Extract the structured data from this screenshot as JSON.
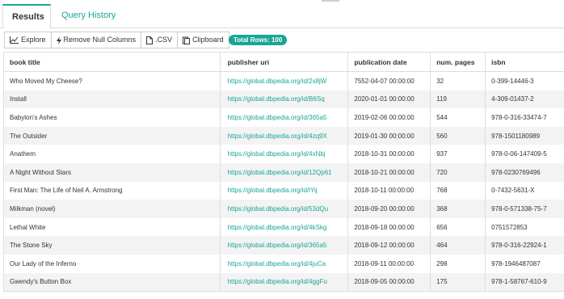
{
  "tabs": {
    "results": "Results",
    "history": "Query History"
  },
  "toolbar": {
    "explore": "Explore",
    "remove_null": "Remove Null Columns",
    "csv": ".CSV",
    "clipboard": "Clipboard"
  },
  "total_rows": "Total Rows: 100",
  "columns": [
    "book title",
    "publisher uri",
    "publication date",
    "num. pages",
    "isbn"
  ],
  "rows": [
    [
      "Who Moved My Cheese?",
      "https://global.dbpedia.org/id/2s8jW",
      "7552-04-07 00:00:00",
      "32",
      "0-399-14446-3"
    ],
    [
      "Install",
      "https://global.dbpedia.org/id/B6Sq",
      "2020-01-01 00:00:00",
      "119",
      "4-309-01437-2"
    ],
    [
      "Babylon's Ashes",
      "https://global.dbpedia.org/id/365a5",
      "2019-02-06 00:00:00",
      "544",
      "978-0-316-33474-7"
    ],
    [
      "The Outsider",
      "https://global.dbpedia.org/id/4zq9X",
      "2019-01-30 00:00:00",
      "560",
      "978-1501180989"
    ],
    [
      "Anathem",
      "https://global.dbpedia.org/id/4xNbj",
      "2018-10-31 00:00:00",
      "937",
      "978-0-06-147409-5"
    ],
    [
      "A Night Without Stars",
      "https://global.dbpedia.org/id/12Qp61",
      "2018-10-21 00:00:00",
      "720",
      "978-0230769496"
    ],
    [
      "First Man: The Life of Neil A. Armstrong",
      "https://global.dbpedia.org/id/iYij",
      "2018-10-11 00:00:00",
      "768",
      "0-7432-5631-X"
    ],
    [
      "Milkman (novel)",
      "https://global.dbpedia.org/id/53dQu",
      "2018-09-20 00:00:00",
      "368",
      "978-0-571338-75-7"
    ],
    [
      "Lethal White",
      "https://global.dbpedia.org/id/4kSkg",
      "2018-09-18 00:00:00",
      "656",
      "0751572853"
    ],
    [
      "The Stone Sky",
      "https://global.dbpedia.org/id/365a5",
      "2018-09-12 00:00:00",
      "464",
      "978-0-316-22924-1"
    ],
    [
      "Our Lady of the Inferno",
      "https://global.dbpedia.org/id/4juCa",
      "2018-09-11 00:00:00",
      "298",
      "978-1946487087"
    ],
    [
      "Gwendy's Button Box",
      "https://global.dbpedia.org/id/4ggFu",
      "2018-09-05 00:00:00",
      "175",
      "978-1-58767-610-9"
    ]
  ],
  "colors": {
    "accent": "#19a596",
    "stripe": "#f3f3f3",
    "border": "#dddddd"
  },
  "icons": {
    "explore": "line-chart-icon",
    "remove_null": "lightning-icon",
    "csv": "file-icon",
    "clipboard": "clipboard-icon"
  }
}
